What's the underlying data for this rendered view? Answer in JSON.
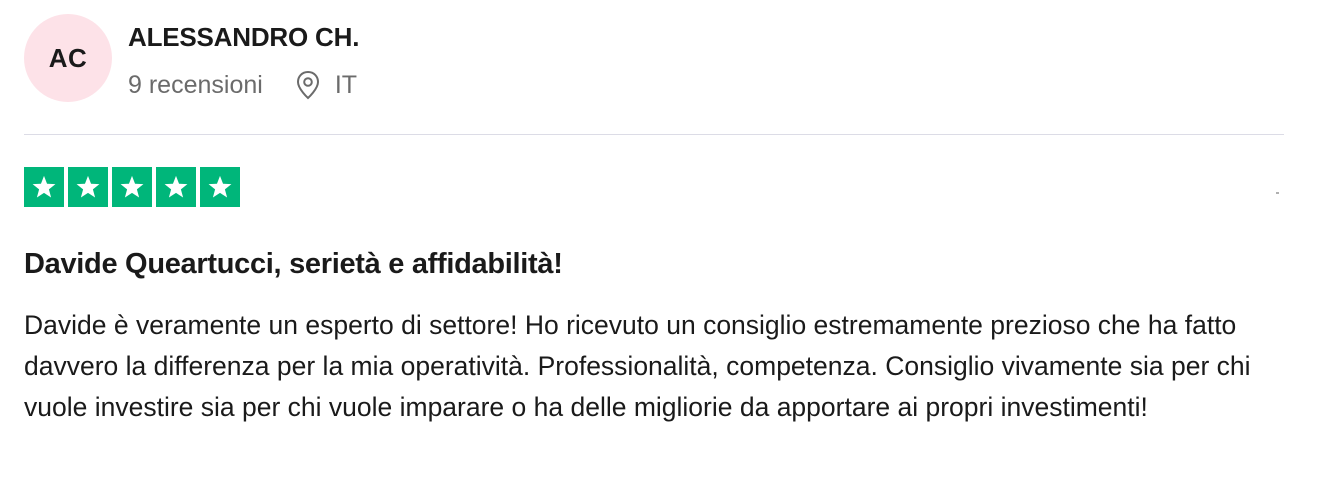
{
  "reviewer": {
    "initials": "AC",
    "name": "ALESSANDRO CH.",
    "review_count": "9 recensioni",
    "country": "IT",
    "avatar_color": "#fde2e8"
  },
  "rating": {
    "stars": 5,
    "max_stars": 5,
    "star_color": "#00b67a"
  },
  "review": {
    "title": "Davide Queartucci, serietà e affidabilità!",
    "body": "Davide è veramente un esperto di settore! Ho ricevuto un consiglio estremamente prezioso che ha fatto davvero la differenza per la mia operatività. Professionalità, competenza. Consiglio vivamente sia per chi vuole investire sia per chi vuole imparare o ha delle migliorie da apportare ai propri investimenti!"
  },
  "icons": {
    "location": "map-pin-icon",
    "star": "star-icon"
  }
}
